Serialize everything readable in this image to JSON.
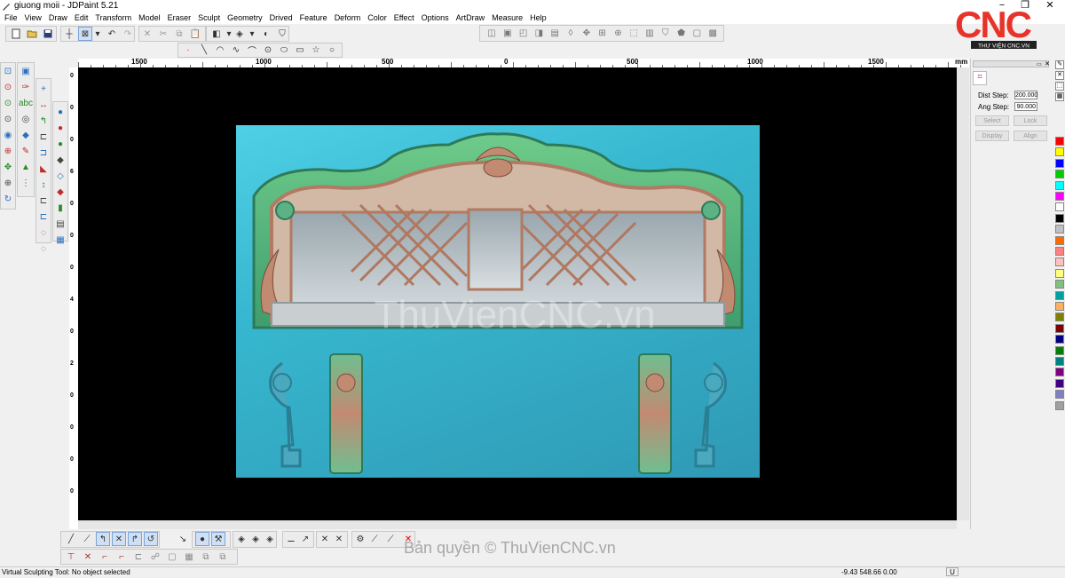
{
  "window": {
    "title": "giuong moii - JDPaint 5.21",
    "minimize": "−",
    "maximize": "❐",
    "close": "✕"
  },
  "menu": [
    "File",
    "View",
    "Draw",
    "Edit",
    "Transform",
    "Model",
    "Eraser",
    "Sculpt",
    "Geometry",
    "Drived",
    "Feature",
    "Deform",
    "Color",
    "Effect",
    "Options",
    "ArtDraw",
    "Measure",
    "Help"
  ],
  "ruler": {
    "top_labels": [
      "1500",
      "1000",
      "500",
      "0",
      "500",
      "1000",
      "1500"
    ],
    "unit": "mm",
    "left_labels": [
      "0",
      "0",
      "0",
      "6",
      "0",
      "0",
      "0",
      "4",
      "0",
      "2",
      "0",
      "0",
      "0",
      "0"
    ]
  },
  "canvas": {
    "watermark": "ThuVienCNC.vn"
  },
  "right_panel": {
    "dist_step_label": "Dist Step:",
    "dist_step_value": "200.000",
    "ang_step_label": "Ang Step:",
    "ang_step_value": "90.000",
    "select_label": "Select",
    "lock_label": "Lock",
    "display_label": "Display",
    "align_label": "Align"
  },
  "palette": [
    "#ff0000",
    "#ffff00",
    "#0000ff",
    "#00cc00",
    "#00ffff",
    "#ff00ff",
    "#ffffff",
    "#000000",
    "#c0c0c0",
    "#ff6a00",
    "#ff8080",
    "#ffc0c0",
    "#ffff80",
    "#80c080",
    "#00a0a0",
    "#ffb060",
    "#808000",
    "#800000",
    "#000080",
    "#008000",
    "#008080",
    "#800080",
    "#400080",
    "#8080c0",
    "#a0a0a0"
  ],
  "logo": {
    "text": "CNC",
    "subtitle": "THƯ VIỆN CNC.VN"
  },
  "copyright": "Bản quyền © ThuVienCNC.vn",
  "status": {
    "message": "Virtual Sculpting Tool: No object selected",
    "coords": "-9.43 548.66 0.00",
    "unit": "U"
  }
}
